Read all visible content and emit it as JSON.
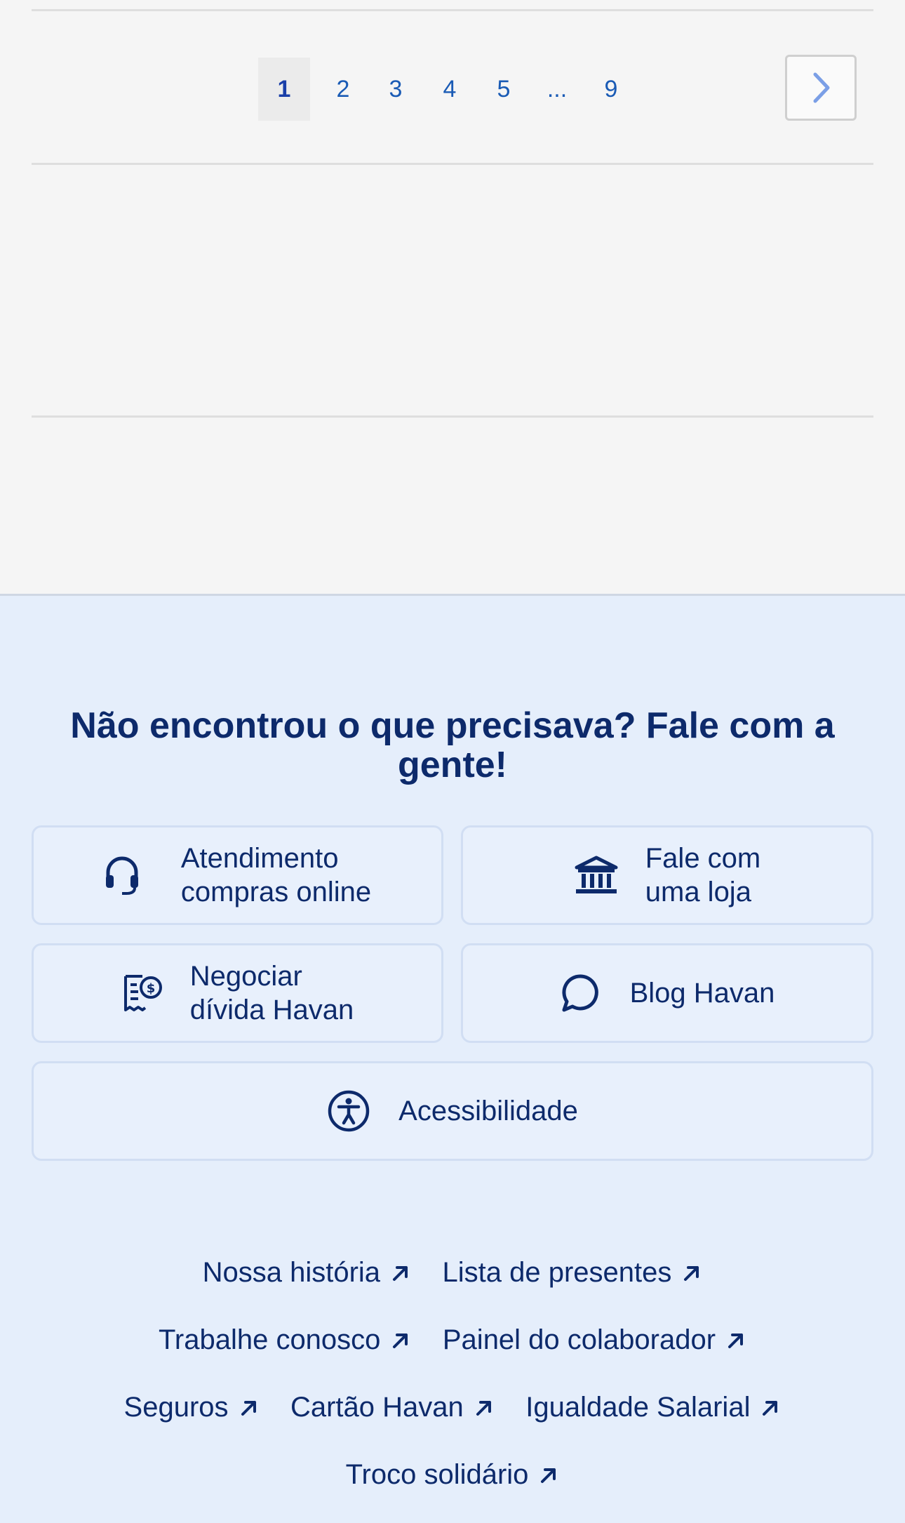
{
  "pagination": {
    "pages": [
      "1",
      "2",
      "3",
      "4",
      "5",
      "...",
      "9"
    ],
    "current": "1",
    "next_icon": "chevron-right-icon"
  },
  "footer": {
    "help_title": "Não encontrou o que precisava? Fale com a gente!",
    "cards": {
      "support": {
        "line1": "Atendimento",
        "line2": "compras online",
        "icon": "headset-icon"
      },
      "store": {
        "line1": "Fale com",
        "line2": "uma loja",
        "icon": "store-icon"
      },
      "debt": {
        "line1": "Negociar",
        "line2": "dívida Havan",
        "icon": "receipt-dollar-icon"
      },
      "blog": {
        "label": "Blog Havan",
        "icon": "chat-bubble-icon"
      },
      "accessibility": {
        "label": "Acessibilidade",
        "icon": "accessibility-icon"
      }
    },
    "links": {
      "history": "Nossa história",
      "gift_list": "Lista de presentes",
      "careers": "Trabalhe conosco",
      "employee_panel": "Painel do colaborador",
      "insurance": "Seguros",
      "card": "Cartão Havan",
      "pay_equity": "Igualdade Salarial",
      "solidarity": "Troco solidário"
    },
    "link_icon": "arrow-up-right-icon"
  },
  "colors": {
    "primary_text": "#0d2a6b",
    "link_blue": "#1a5bb5",
    "footer_bg": "#e5eefb",
    "page_bg": "#f5f5f5"
  }
}
